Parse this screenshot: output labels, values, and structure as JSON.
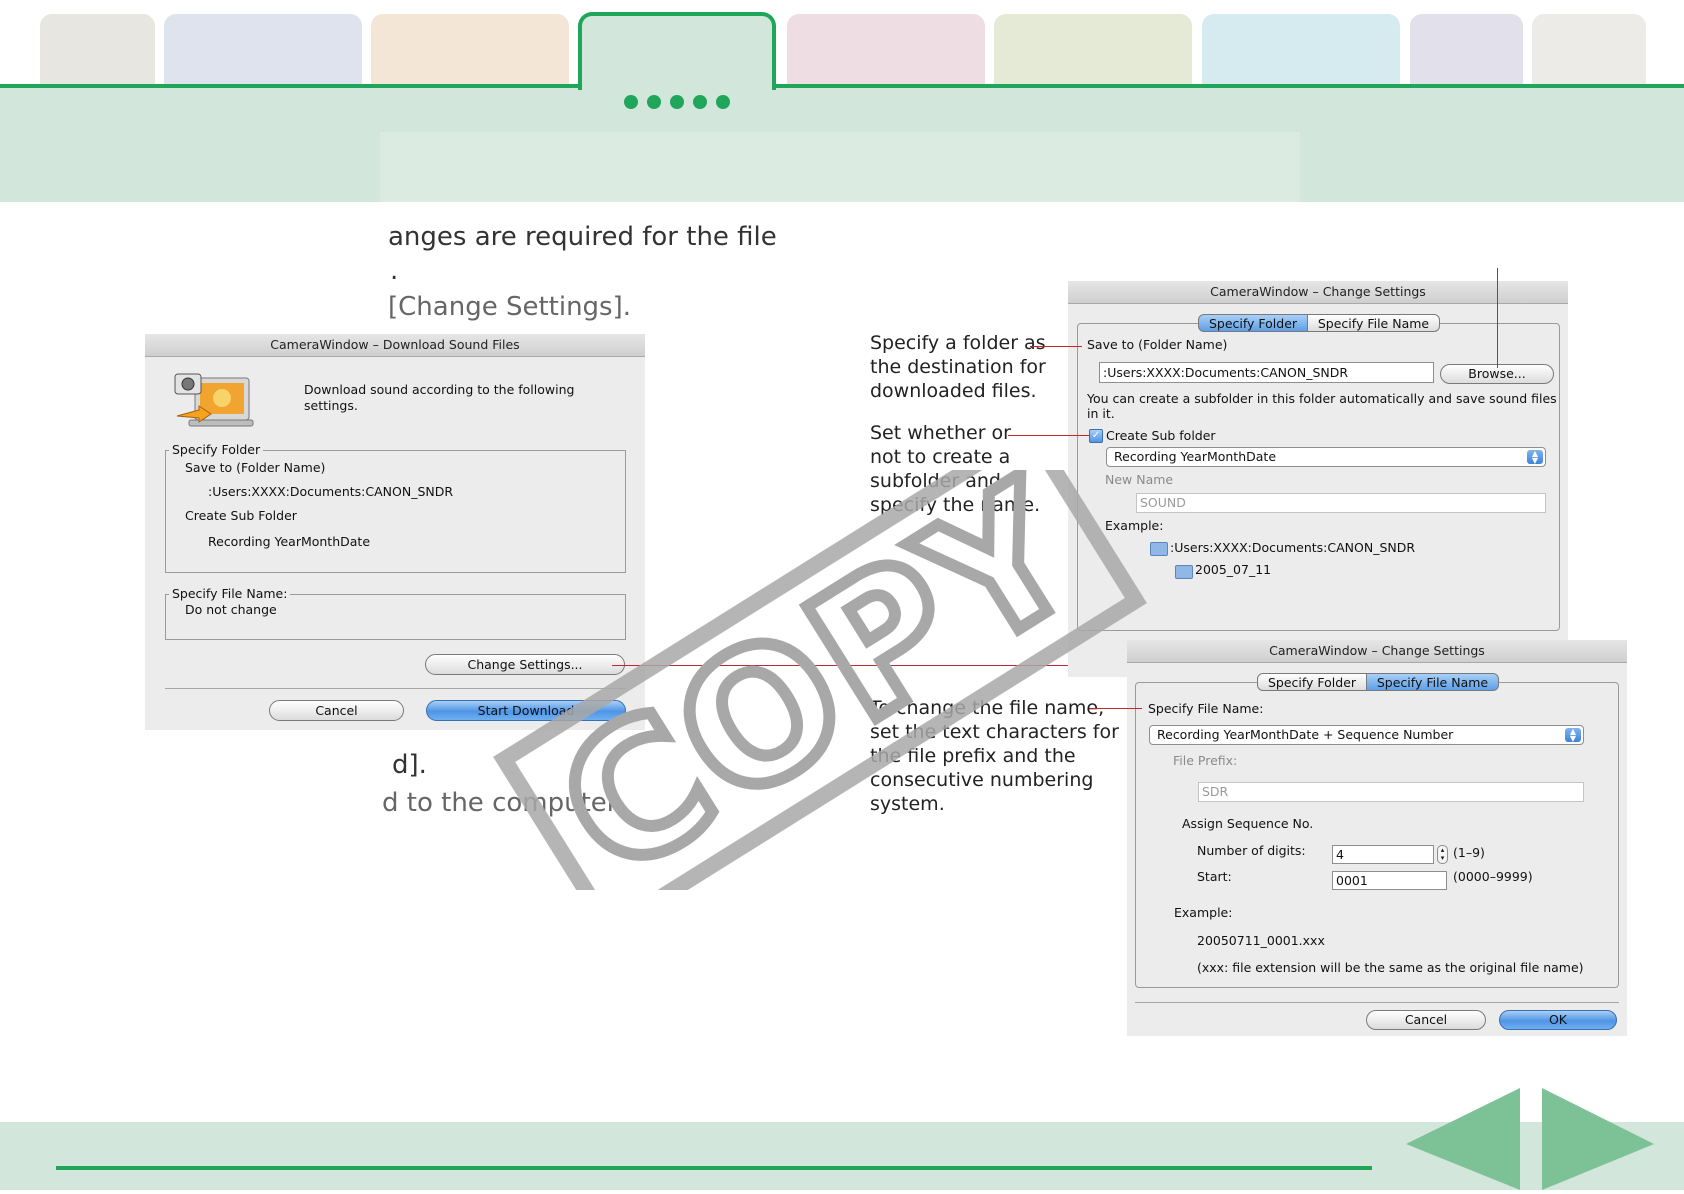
{
  "colors": {
    "accent": "#1fa65a",
    "header_band": "#d3e6dc",
    "callout_line": "#c0282d",
    "nav_arrow": "#7dc196"
  },
  "nav_tabs": [
    {
      "color": "#e8e6e1"
    },
    {
      "color": "#dfe3ee"
    },
    {
      "color": "#f3e6d6"
    },
    {
      "color": "#d3e6dc",
      "active": true
    },
    {
      "color": "#efdde4"
    },
    {
      "color": "#e5ead6"
    },
    {
      "color": "#d6ebef"
    },
    {
      "color": "#e2e0ea"
    },
    {
      "color": "#ecebe7"
    }
  ],
  "body_text": {
    "line1": "anges are required for the file",
    "line2": ".",
    "line3": "[Change Settings].",
    "line4": "d].",
    "line5": "d to the computer."
  },
  "download_dialog": {
    "title": "CameraWindow – Download Sound Files",
    "message": "Download sound according to the following settings.",
    "folder_group": "Specify Folder",
    "save_to_label": "Save to (Folder Name)",
    "save_to_value": ":Users:XXXX:Documents:CANON_SNDR",
    "subfolder_label": "Create Sub Folder",
    "subfolder_value": "Recording YearMonthDate",
    "filename_group": "Specify File Name:",
    "filename_value": "Do not change",
    "change_settings_button": "Change Settings...",
    "cancel_button": "Cancel",
    "start_button": "Start Download"
  },
  "callouts": {
    "folder": [
      "Specify a folder as",
      "the destination for",
      "downloaded files."
    ],
    "subfolder": [
      "Set whether or",
      "not to create a",
      "subfolder and",
      "specify the name."
    ],
    "filename": [
      "To change the file name,",
      "set the text characters for",
      "the file prefix and the",
      "consecutive numbering",
      "system."
    ]
  },
  "settings_folder_dialog": {
    "title": "CameraWindow – Change Settings",
    "tab_folder": "Specify Folder",
    "tab_filename": "Specify File Name",
    "save_to_label": "Save to (Folder Name)",
    "save_to_value": ":Users:XXXX:Documents:CANON_SNDR",
    "browse_button": "Browse...",
    "hint": "You can create a subfolder in this folder automatically and save sound files in it.",
    "create_sub_label": "Create Sub folder",
    "create_sub_checked": true,
    "subfolder_option": "Recording YearMonthDate",
    "new_name_label": "New Name",
    "new_name_value": "SOUND",
    "example_label": "Example:",
    "example_root": ":Users:XXXX:Documents:CANON_SNDR",
    "example_sub": "2005_07_11"
  },
  "settings_file_dialog": {
    "title": "CameraWindow – Change Settings",
    "tab_folder": "Specify Folder",
    "tab_filename": "Specify File Name",
    "file_name_label": "Specify File Name:",
    "file_name_option": "Recording YearMonthDate + Sequence Number",
    "prefix_label": "File Prefix:",
    "prefix_value": "SDR",
    "assign_label": "Assign Sequence No.",
    "digits_label": "Number of digits:",
    "digits_value": "4",
    "digits_range": "(1–9)",
    "start_label": "Start:",
    "start_value": "0001",
    "start_range": "(0000–9999)",
    "example_label": "Example:",
    "example_value": "20050711_0001.xxx",
    "example_note": "(xxx: file extension will be the same as the original file name)",
    "cancel_button": "Cancel",
    "ok_button": "OK"
  },
  "watermark": "COPY"
}
